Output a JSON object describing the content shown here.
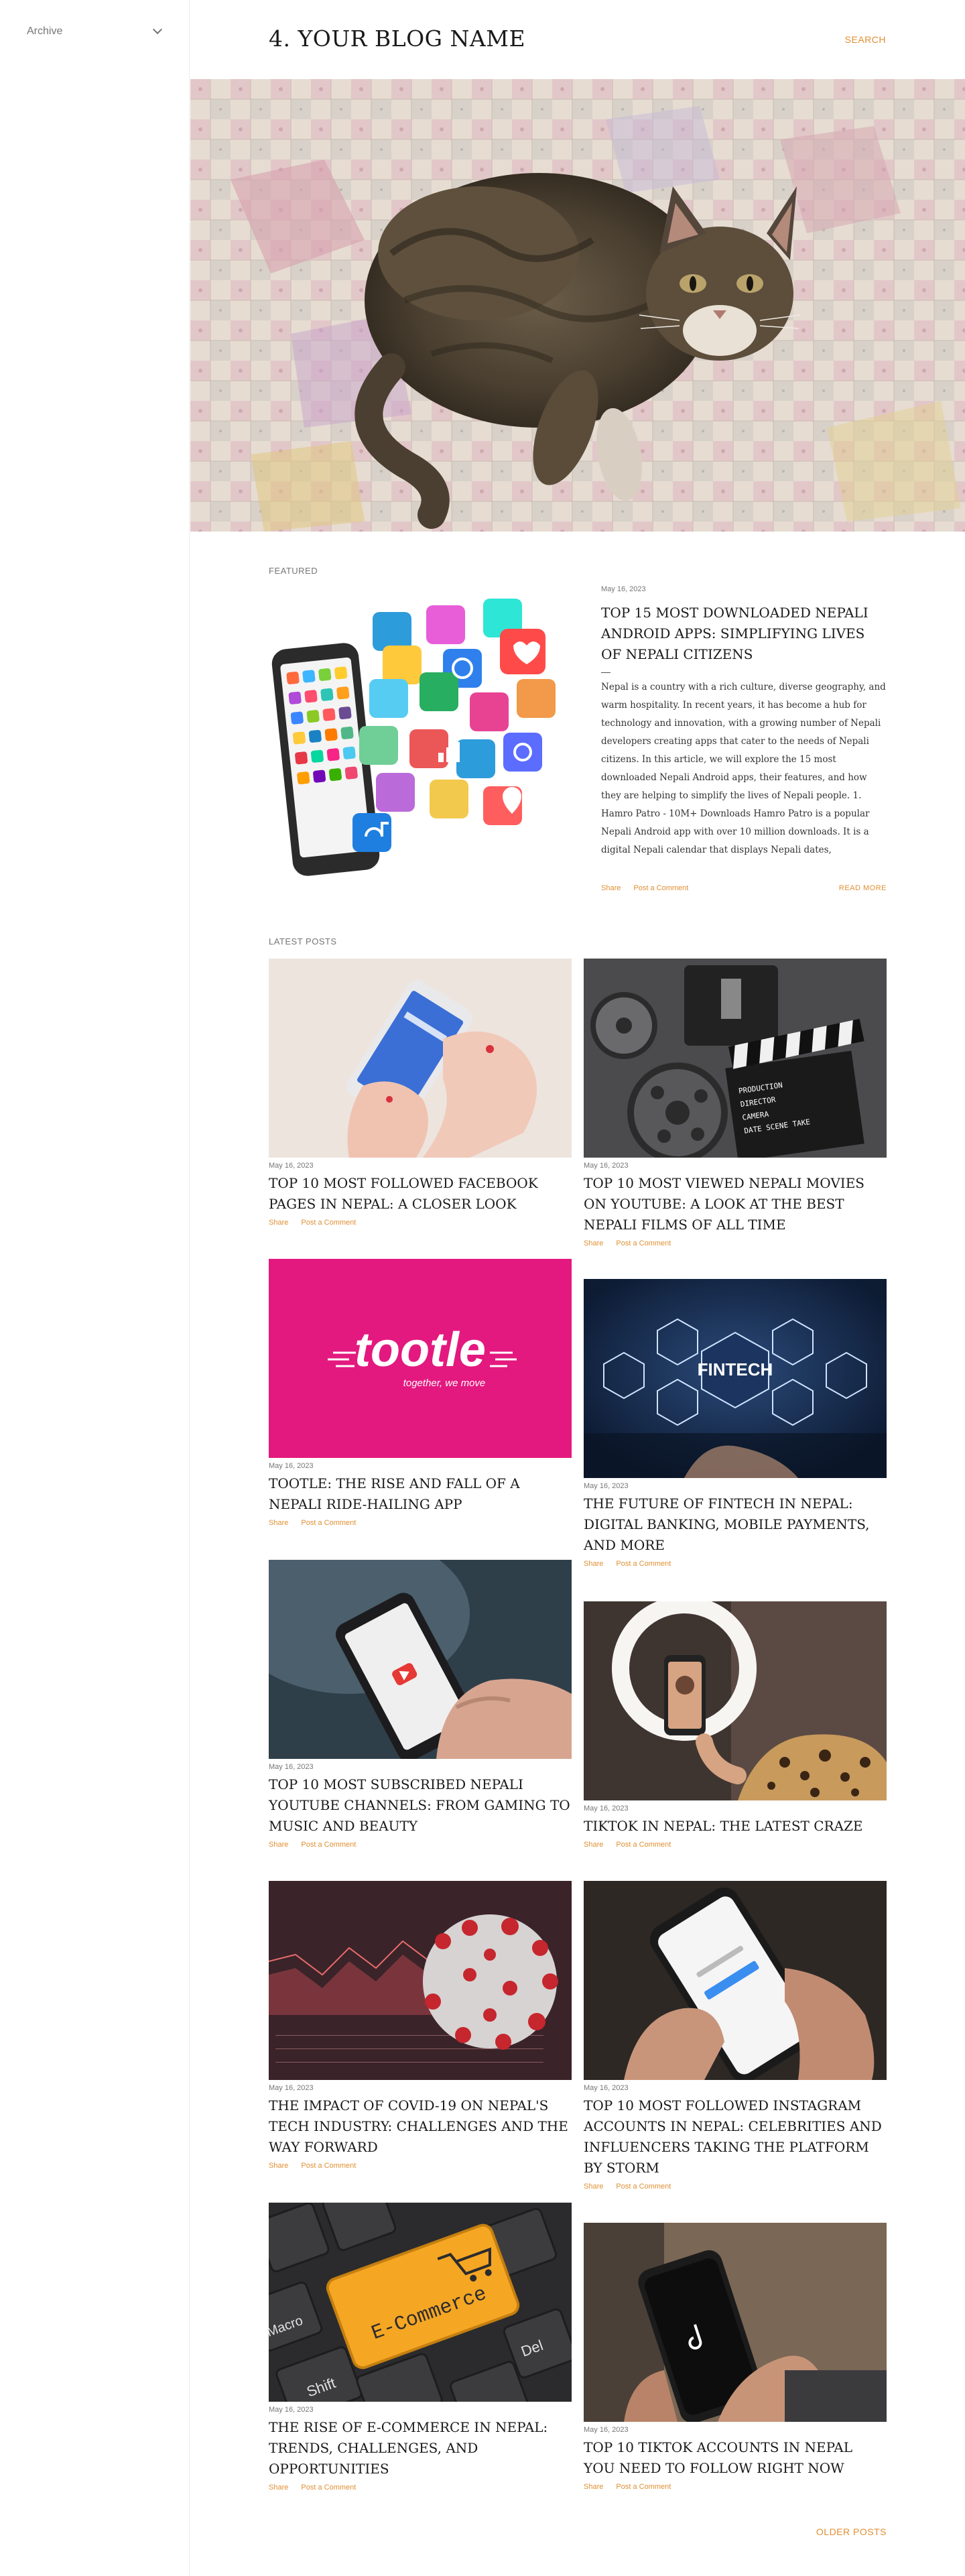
{
  "sidebar": {
    "archive_label": "Archive"
  },
  "header": {
    "blog_title": "4. YOUR BLOG NAME",
    "search_label": "SEARCH"
  },
  "featured": {
    "section_label": "FEATURED",
    "date": "May 16, 2023",
    "title": "TOP 15 MOST DOWNLOADED NEPALI ANDROID APPS: SIMPLIFYING LIVES OF NEPALI CITIZENS",
    "separator": "—",
    "body": "Nepal is a country with a rich culture, diverse geography, and warm hospitality. In recent years, it has become a hub for technology and innovation, with a growing number of Nepali developers creating apps that cater to the needs of Nepali citizens. In this article, we will explore the 15 most downloaded Nepali Android apps, their features, and how they are helping to simplify the lives of Nepali people. 1. Hamro Patro - 10M+ Downloads Hamro Patro is a popular Nepali Android app with over 10 million downloads. It is a digital Nepali calendar that displays Nepali dates,",
    "ellipsis": "…",
    "share": "Share",
    "comment": "Post a Comment",
    "read_more": "READ MORE"
  },
  "latest": {
    "section_label": "LATEST POSTS",
    "share": "Share",
    "comment": "Post a Comment",
    "posts": [
      {
        "date": "May 16, 2023",
        "title": "TOP 10 MOST FOLLOWED FACEBOOK PAGES IN NEPAL: A CLOSER LOOK",
        "image": "facebook-phone"
      },
      {
        "date": "May 16, 2023",
        "title": "TOP 10 MOST VIEWED NEPALI MOVIES ON YOUTUBE: A LOOK AT THE BEST NEPALI FILMS OF ALL TIME",
        "image": "film-clapper"
      },
      {
        "date": "May 16, 2023",
        "title": "TOOTLE: THE RISE AND FALL OF A NEPALI RIDE-HAILING APP",
        "image": "tootle-logo"
      },
      {
        "date": "May 16, 2023",
        "title": "THE FUTURE OF FINTECH IN NEPAL: DIGITAL BANKING, MOBILE PAYMENTS, AND MORE",
        "image": "fintech"
      },
      {
        "date": "May 16, 2023",
        "title": "TOP 10 MOST SUBSCRIBED NEPALI YOUTUBE CHANNELS: FROM GAMING TO MUSIC AND BEAUTY",
        "image": "youtube-phone"
      },
      {
        "date": "May 16, 2023",
        "title": "TIKTOK IN NEPAL: THE LATEST CRAZE",
        "image": "ring-light"
      },
      {
        "date": "May 16, 2023",
        "title": "THE IMPACT OF COVID-19 ON NEPAL'S TECH INDUSTRY: CHALLENGES AND THE WAY FORWARD",
        "image": "covid-chart"
      },
      {
        "date": "May 16, 2023",
        "title": "TOP 10 MOST FOLLOWED INSTAGRAM ACCOUNTS IN NEPAL: CELEBRITIES AND INFLUENCERS TAKING THE PLATFORM BY STORM",
        "image": "instagram-phone"
      },
      {
        "date": "May 16, 2023",
        "title": "THE RISE OF E-COMMERCE IN NEPAL: TRENDS, CHALLENGES, AND OPPORTUNITIES",
        "image": "ecommerce-key"
      },
      {
        "date": "May 16, 2023",
        "title": "TOP 10 TIKTOK ACCOUNTS IN NEPAL YOU NEED TO FOLLOW RIGHT NOW",
        "image": "tiktok-phone"
      }
    ]
  },
  "thumb_text": {
    "tootle_logo": "tootle",
    "tootle_tagline": "together, we move",
    "fintech_label": "FINTECH",
    "ecommerce_label": "E-Commerce",
    "key_shift": "Shift",
    "key_macro": "Macro",
    "key_del": "Del",
    "clapper_line1": "PRODUCTION",
    "clapper_line2": "DIRECTOR",
    "clapper_line3": "CAMERA",
    "clapper_line4": "DATE    SCENE    TAKE"
  },
  "pagination": {
    "older_label": "OLDER POSTS"
  },
  "colors": {
    "accent": "#e08f33",
    "text": "#1a1a1a",
    "muted": "#757575",
    "tootle_pink": "#e3197f"
  }
}
